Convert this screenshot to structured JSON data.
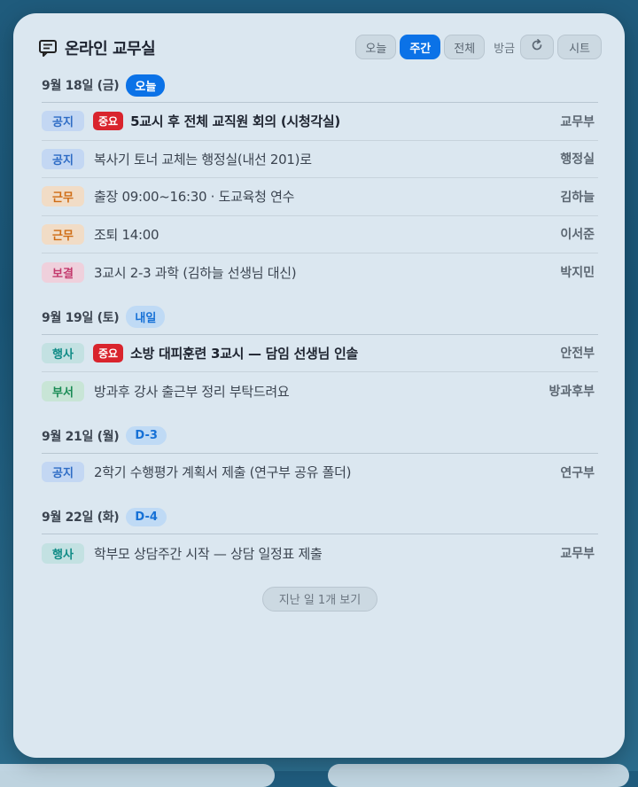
{
  "header": {
    "title": "온라인 교무실",
    "icon": "message-board-icon",
    "tabs": [
      {
        "label": "오늘",
        "active": false
      },
      {
        "label": "주간",
        "active": true
      },
      {
        "label": "전체",
        "active": false
      }
    ],
    "refreshed": "방금",
    "refresh_icon": "refresh-icon",
    "sheet_label": "시트"
  },
  "days": [
    {
      "date": "9월 18일 (금)",
      "badge": "오늘",
      "items": [
        {
          "tag": "공지",
          "important": "중요",
          "text": "5교시 후 전체 교직원 회의 (시청각실)",
          "dept": "교무부"
        },
        {
          "tag": "공지",
          "text": "복사기 토너 교체는 행정실(내선 201)로",
          "dept": "행정실"
        },
        {
          "tag": "근무",
          "text": "출장 09:00~16:30 · 도교육청 연수",
          "dept": "김하늘"
        },
        {
          "tag": "근무",
          "text": "조퇴 14:00",
          "dept": "이서준"
        },
        {
          "tag": "보결",
          "text": "3교시 2-3 과학 (김하늘 선생님 대신)",
          "dept": "박지민"
        }
      ]
    },
    {
      "date": "9월 19일 (토)",
      "badge": "내일",
      "items": [
        {
          "tag": "행사",
          "important": "중요",
          "text": "소방 대피훈련 3교시 — 담임 선생님 인솔",
          "dept": "안전부"
        },
        {
          "tag": "부서",
          "text": "방과후 강사 출근부 정리 부탁드려요",
          "dept": "방과후부"
        }
      ]
    },
    {
      "date": "9월 21일 (월)",
      "badge": "D-3",
      "items": [
        {
          "tag": "공지",
          "text": "2학기 수행평가 계획서 제출 (연구부 공유 폴더)",
          "dept": "연구부"
        }
      ]
    },
    {
      "date": "9월 22일 (화)",
      "badge": "D-4",
      "items": [
        {
          "tag": "행사",
          "text": "학부모 상담주간 시작 — 상담 일정표 제출",
          "dept": "교무부"
        }
      ]
    }
  ],
  "more_label": "지난 일 1개 보기",
  "colors": {
    "accent": "#0b72e7",
    "important": "#d9242d",
    "tag_공지": "#2e6cc5",
    "tag_근무": "#cf6c14",
    "tag_보결": "#c33a6d",
    "tag_행사": "#0f8b86",
    "tag_부서": "#1a8b55"
  }
}
